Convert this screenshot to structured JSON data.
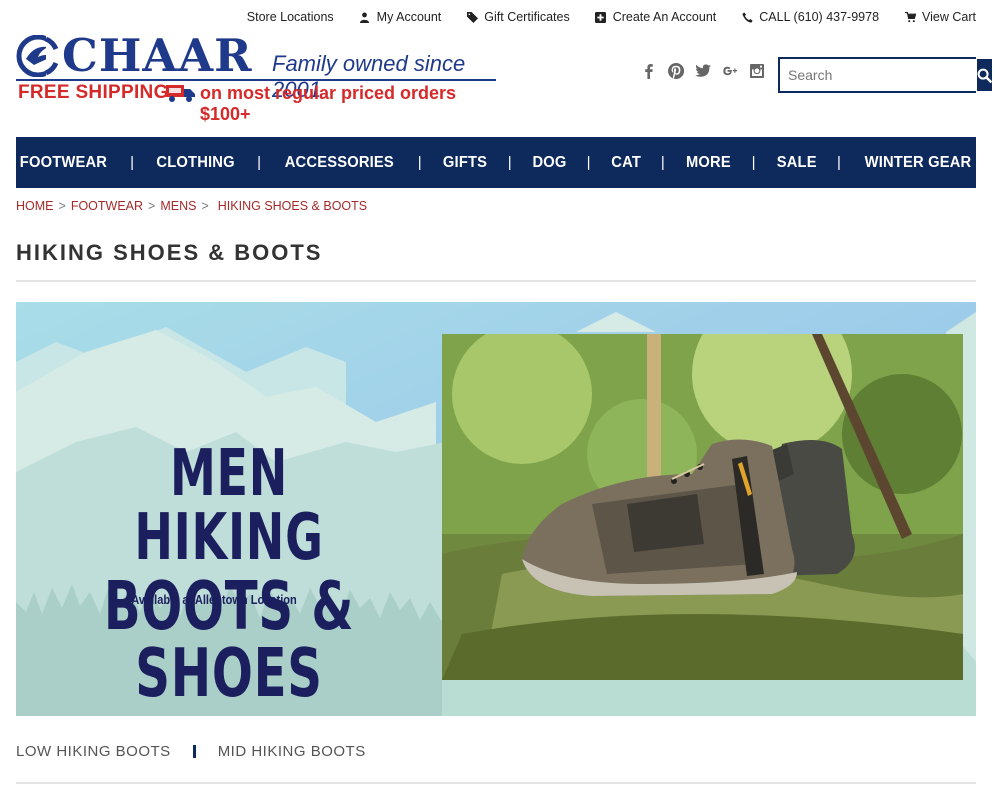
{
  "utility": {
    "store_locations": "Store Locations",
    "my_account": "My Account",
    "gift_certificates": "Gift Certificates",
    "create_account": "Create An Account",
    "call": "CALL (610) 437-9978",
    "view_cart": "View Cart"
  },
  "logo": {
    "wordmark": "CHAAR",
    "tagline": "Family owned since 2001",
    "shipping_a": "FREE SHIPPING",
    "shipping_b": "on most regular priced orders $100+"
  },
  "social": [
    "facebook-icon",
    "pinterest-icon",
    "twitter-icon",
    "google-plus-icon",
    "instagram-icon"
  ],
  "search": {
    "placeholder": "Search"
  },
  "nav": [
    "FOOTWEAR",
    "CLOTHING",
    "ACCESSORIES",
    "GIFTS",
    "DOG",
    "CAT",
    "MORE",
    "SALE",
    "WINTER GEAR"
  ],
  "breadcrumb": [
    "HOME",
    "FOOTWEAR",
    "MENS",
    "HIKING SHOES & BOOTS"
  ],
  "page_title": "HIKING SHOES & BOOTS",
  "banner": {
    "line1": "MEN HIKING",
    "line2": "BOOTS & SHOES",
    "sub": "Available at Allentown Location"
  },
  "subcategories": [
    "LOW HIKING BOOTS",
    "MID HIKING BOOTS"
  ],
  "colors": {
    "brand_navy": "#0e2a5c",
    "logo_blue": "#1f3a8a",
    "accent_red": "#d62a2a",
    "crumb_red": "#a52a2a"
  }
}
